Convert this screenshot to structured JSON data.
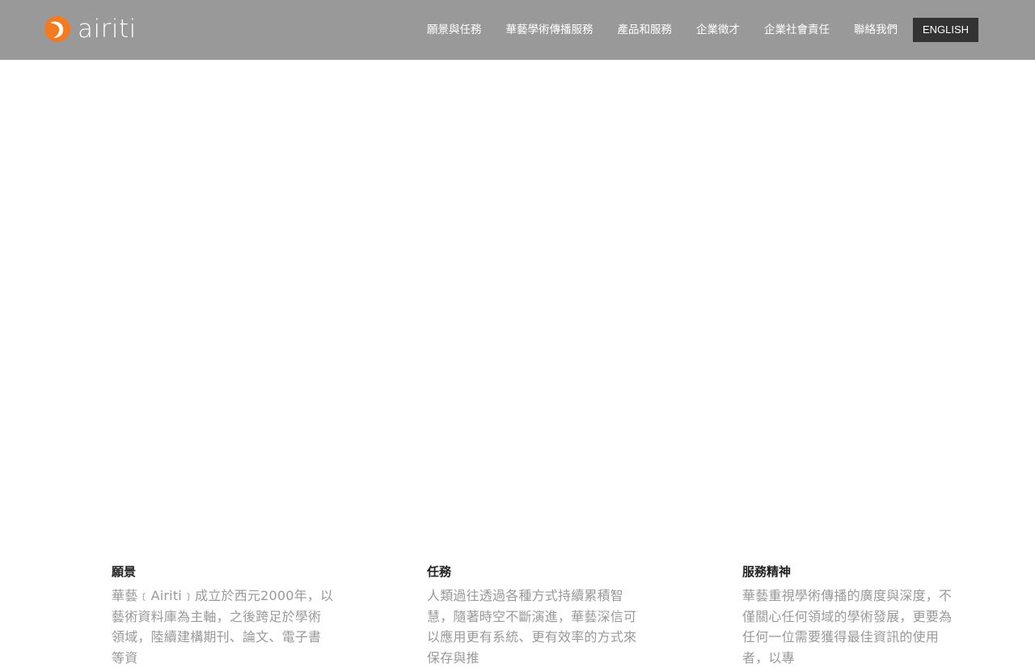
{
  "header": {
    "logo_text": "airiti",
    "brand_color": "#f47a20",
    "nav": [
      {
        "label": "願景與任務"
      },
      {
        "label": "華藝學術傳播服務"
      },
      {
        "label": "產品和服務"
      },
      {
        "label": "企業徵才"
      },
      {
        "label": "企業社會責任"
      },
      {
        "label": "聯絡我們"
      }
    ],
    "language_button": "ENGLISH"
  },
  "sections": [
    {
      "title": "願景",
      "text": "華藝﹝Airiti﹞成立於西元2000年，以藝術資料庫為主軸，之後跨足於學術領域，陸續建構期刊、論文、電子書等資"
    },
    {
      "title": "任務",
      "text": "人類過往透過各種方式持續累積智慧，隨著時空不斷演進，華藝深信可以應用更有系統、更有效率的方式來保存與推"
    },
    {
      "title": "服務精神",
      "text": "華藝重視學術傳播的廣度與深度，不僅關心任何領域的學術發展，更要為任何一位需要獲得最佳資訊的使用者，以專"
    }
  ]
}
